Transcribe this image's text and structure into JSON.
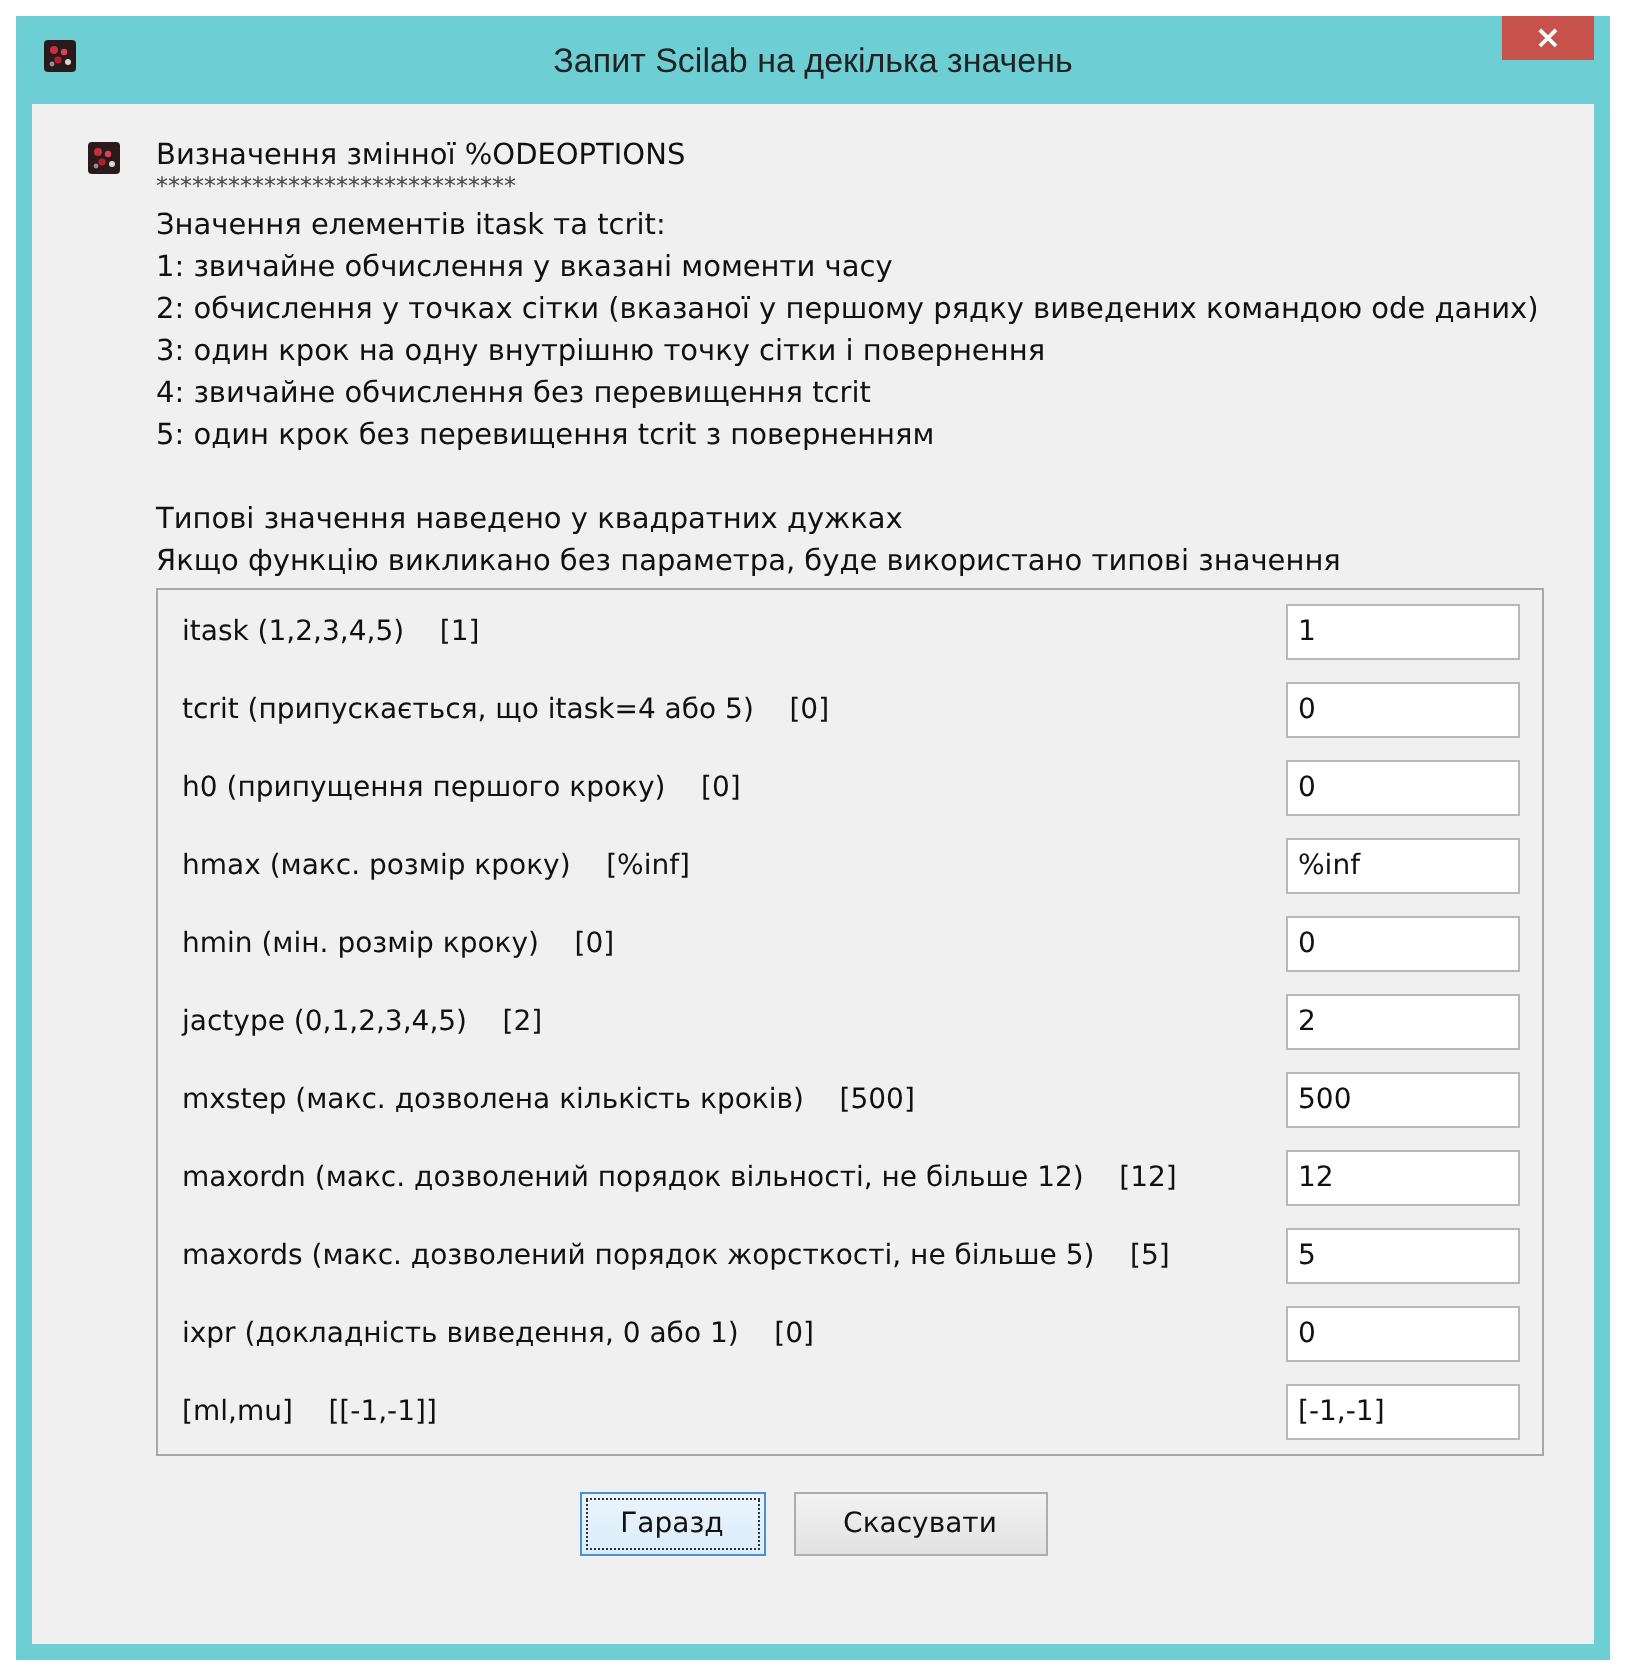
{
  "window": {
    "title": "Запит Scilab на декілька значень",
    "close": "×"
  },
  "header": "Визначення змінної %ODEOPTIONS",
  "separator": "******************************",
  "description": [
    "Значення елементів itask та tcrit:",
    "1: звичайне обчислення у вказані моменти часу",
    "2: обчислення у точках сітки (вказаної у першому рядку виведених командою ode даних)",
    "3: один крок на одну внутрішню точку сітки і повернення",
    "4: звичайне обчислення без перевищення tcrit",
    "5: один крок без перевищення tcrit з поверненням"
  ],
  "notes": [
    "Типові значення наведено у квадратних дужках",
    "Якщо функцію викликано без параметра, буде використано типові значення"
  ],
  "fields": [
    {
      "label": "itask (1,2,3,4,5)    [1]",
      "value": "1"
    },
    {
      "label": "tcrit (припускається, що itask=4 або 5)    [0]",
      "value": "0"
    },
    {
      "label": "h0 (припущення першого кроку)    [0]",
      "value": "0"
    },
    {
      "label": "hmax (макс. розмір кроку)    [%inf]",
      "value": "%inf"
    },
    {
      "label": "hmin (мін. розмір кроку)    [0]",
      "value": "0"
    },
    {
      "label": "jactype (0,1,2,3,4,5)    [2]",
      "value": "2"
    },
    {
      "label": "mxstep (макс. дозволена кількість кроків)    [500]",
      "value": "500"
    },
    {
      "label": "maxordn (макс. дозволений порядок вільності, не більше 12)    [12]",
      "value": "12"
    },
    {
      "label": "maxords (макс. дозволений порядок жорсткості, не більше 5)    [5]",
      "value": "5"
    },
    {
      "label": "ixpr (докладність виведення, 0 або 1)    [0]",
      "value": "0"
    },
    {
      "label": "[ml,mu]    [[-1,-1]]",
      "value": "[-1,-1]"
    }
  ],
  "buttons": [
    {
      "label": "Гаразд",
      "focused": true
    },
    {
      "label": "Скасувати",
      "focused": false
    }
  ]
}
